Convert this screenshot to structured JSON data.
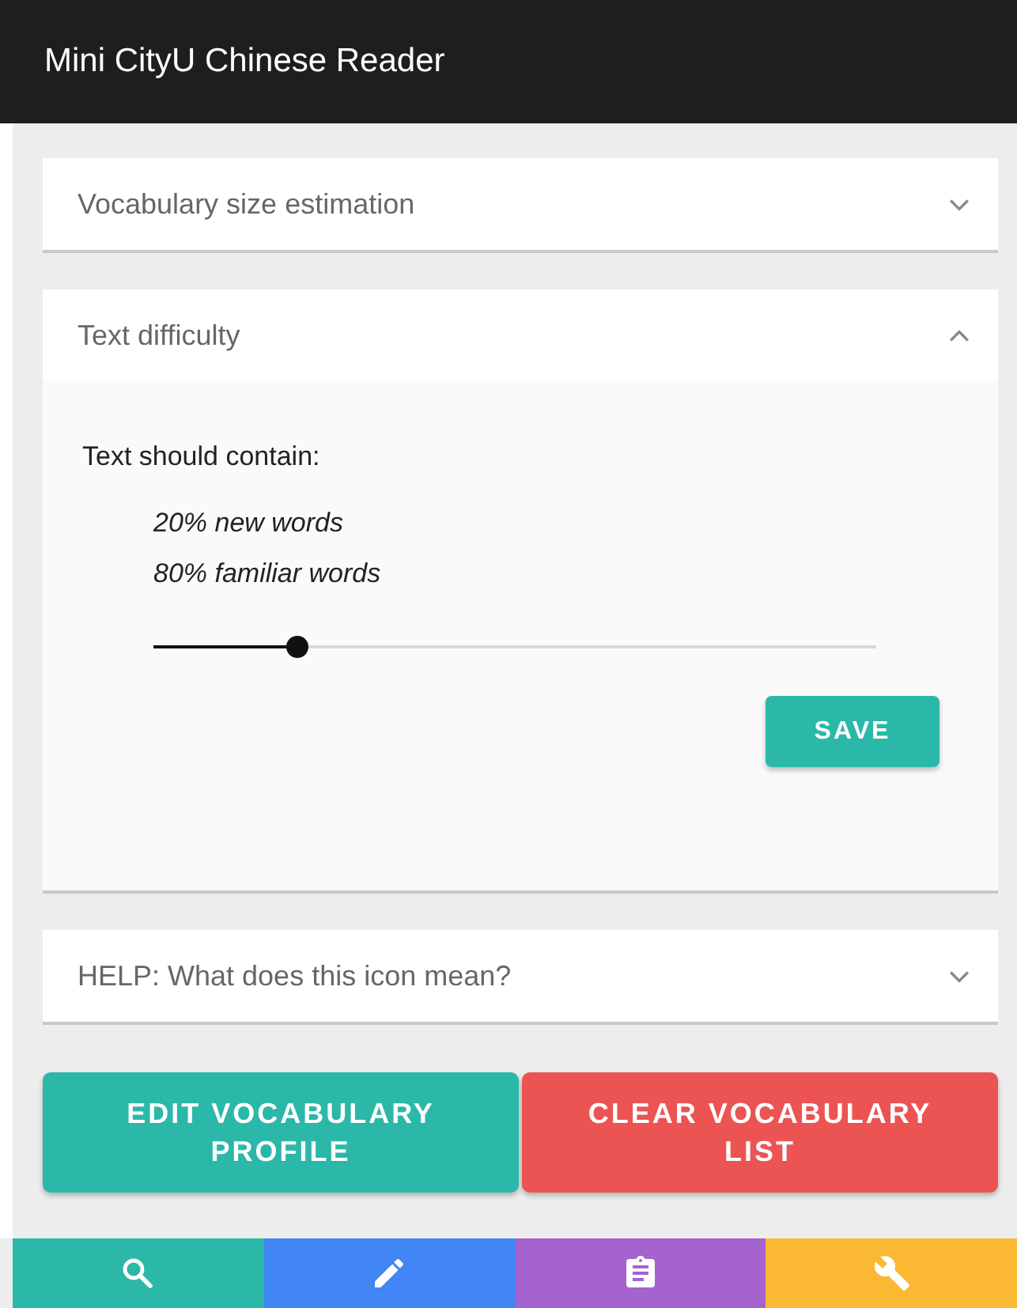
{
  "app_bar": {
    "title": "Mini CityU Chinese Reader"
  },
  "panels": [
    {
      "title": "Vocabulary size estimation",
      "expanded": false
    },
    {
      "title": "Text difficulty",
      "expanded": true,
      "content": {
        "label": "Text should contain:",
        "lines": [
          "20% new words",
          "80% familiar words"
        ],
        "slider": {
          "level": 0.2
        },
        "save_button": "SAVE"
      }
    },
    {
      "title": "HELP: What does this icon mean?",
      "expanded": false
    }
  ],
  "buttons": [
    {
      "label": "EDIT VOCABULARY PROFILE",
      "kind": "primary"
    },
    {
      "label": "CLEAR VOCABULARY LIST",
      "kind": "danger"
    }
  ],
  "bottom_nav": [
    {
      "color": "#2bb8a8"
    },
    {
      "color": "#4285f4"
    },
    {
      "color": "#a463cf"
    },
    {
      "color": "#fbb833"
    }
  ]
}
